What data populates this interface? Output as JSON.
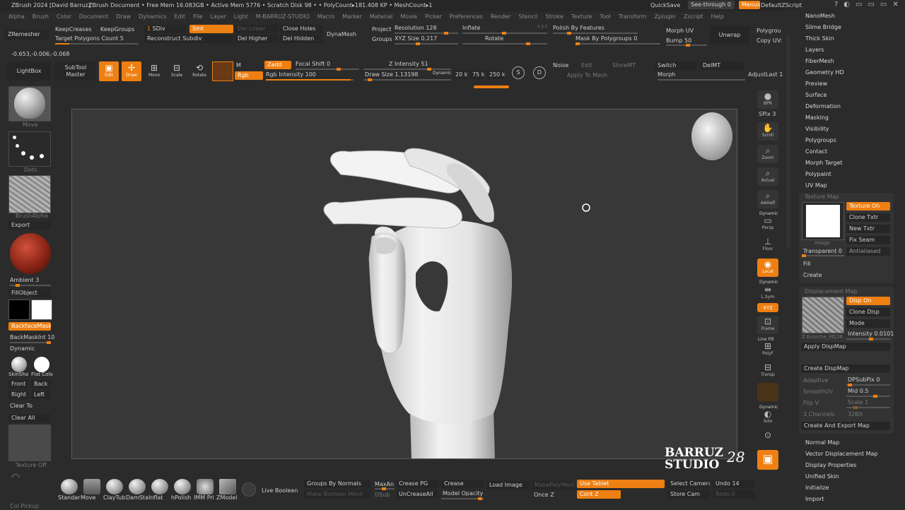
{
  "title_bar": {
    "app": "ZBrush 2024 [David Barruz]",
    "document": "ZBrush Document",
    "stats": "• Free Mem 16.083GB • Active Mem 5776 • Scratch Disk 98 • • PolyCount▸181.408 KP • MeshCount▸1",
    "quicksave": "QuickSave",
    "see_through": "See-through 0",
    "menus": "Menus",
    "default_script": "DefaultZScript"
  },
  "menu": [
    "Alpha",
    "Brush",
    "Color",
    "Document",
    "Draw",
    "Dynamics",
    "Edit",
    "File",
    "Layer",
    "Light",
    "M-BARRUZ-STUDIO",
    "Macro",
    "Marker",
    "Material",
    "Movie",
    "Picker",
    "Preferences",
    "Render",
    "Stencil",
    "Stroke",
    "Texture",
    "Tool",
    "Transform",
    "Zplugin",
    "Zscript",
    "Help"
  ],
  "tool_row1": {
    "zremesher": "ZRemesher",
    "keepcreases": "KeepCreases",
    "keepgroups": "KeepGroups",
    "target": "Target Polygons Count 5",
    "sdiv": "SDiv",
    "sdiv_num": "1",
    "smt": "Smt",
    "reconstruct": "Reconstruct Subdiv",
    "del_lower": "Del Lower",
    "del_higher": "Del Higher",
    "close_holes": "Close Holes",
    "del_hidden": "Del Hidden",
    "dynamesh": "DynaMesh",
    "project": "Project",
    "groups": "Groups",
    "resolution": "Resolution 128",
    "xyz_size": "XYZ Size 0.217",
    "inflate": "Inflate",
    "rotate": "Rotate",
    "xyz_mark": "x y z",
    "polish": "Polish By Features",
    "mask_pg": "Mask By Polygroups 0",
    "morph_uv": "Morph UV",
    "bump": "Bump 50",
    "unwrap": "Unwrap",
    "polygroups": "Polygrou",
    "copy_uv": "Copy UV:"
  },
  "coords": "-0.653,-0.006,-0.068",
  "tool_row2": {
    "lightbox": "LightBox",
    "subtool": "SubTool",
    "master": "Master",
    "edit": "Edit",
    "draw": "Draw",
    "move": "Move",
    "scale": "Scale",
    "rotate": "Rotate",
    "m": "M",
    "zadd": "Zadd",
    "rgb": "Rgb",
    "focal": "Focal Shift 0",
    "rgb_int": "Rgb Intensity 100",
    "z_int": "Z Intensity 51",
    "dynamic": "Dynamic",
    "draw_size": "Draw Size 1.13198",
    "k20": "20 k",
    "k75": "75 k",
    "k250": "250 k",
    "noise": "Noise",
    "edit2": "Edit",
    "storemt": "StoreMT",
    "apply_mesh": "Apply To Mesh",
    "switch": "Switch",
    "delmt": "DelMT",
    "morph": "Morph",
    "adjust": "AdjustLast 1"
  },
  "left_shelf": {
    "move": "Move",
    "dots": "Dots",
    "brush_alpha": "BrushAlpha",
    "export": "Export",
    "ambient": "Ambient 3",
    "fillobject": "FillObject",
    "backfacemask": "BackfaceMask",
    "backmaskint": "BackMaskInt 10",
    "dynamic": "Dynamic",
    "skinshade": "SkinSha",
    "flatcolor": "Flat Colo",
    "front": "Front",
    "back": "Back",
    "right": "Right",
    "left": "Left",
    "clear_to": "Clear To",
    "clear_all": "Clear All",
    "texture_off": "Texture Off",
    "col_pickup": "Col Pickup"
  },
  "right_shelf": {
    "bpr": "BPR",
    "spix": "SPix 3",
    "scroll": "Scroll",
    "zoom": "Zoom",
    "actual": "Actual",
    "aahalf": "AAHalf",
    "dynamic": "Dynamic",
    "persp": "Persp",
    "floor": "Floor",
    "local": "Local",
    "dynamic2": "Dynamic",
    "lsym": "L.Sym",
    "xyz": "XYZ",
    "frame": "Frame",
    "line_fill": "Line Fill",
    "polyf": "PolyF",
    "transp": "Transp",
    "dynamic3": "Dynamic",
    "solo": "Solo"
  },
  "tool_menu": [
    "NanoMesh",
    "Slime Bridge",
    "Thick Skin",
    "Layers",
    "FiberMesh",
    "Geometry HD",
    "Preview",
    "Surface",
    "Deformation",
    "Masking",
    "Visibility",
    "Polygroups",
    "Contact",
    "Morph Target",
    "Polypaint",
    "UV Map"
  ],
  "texture_map": {
    "header": "Texture Map",
    "texture_on": "Texture On",
    "clone_txtr": "Clone Txtr",
    "new_txtr": "New Txtr",
    "fix_seam": "Fix Seam",
    "transparent": "Transparent 0",
    "antialiased": "Antialiased",
    "image": "Image",
    "fill": "Fill",
    "create": "Create"
  },
  "displacement_map": {
    "header": "Displacement Map",
    "disp_on": "Disp On",
    "clone_disp": "Clone Disp",
    "mode": "Mode",
    "intensity": "Intensity 0.0101",
    "thumb_label": "Z Ecorche_M126",
    "apply": "Apply DispMap",
    "create": "Create DispMap",
    "adaptive": "Adaptive",
    "dpsubpix": "DPSubPix 0",
    "smoothuv": "SmoothUV",
    "mid": "Mid 0.5",
    "flipv": "Flip V",
    "scale": "Scale 1",
    "channels": "3 Channels",
    "bit": "32Bit",
    "create_export": "Create And Export Map"
  },
  "tool_menu2": [
    "Normal Map",
    "Vector Displacement Map",
    "Display Properties",
    "Unified Skin",
    "Initialize",
    "Import"
  ],
  "bottom": {
    "brushes": [
      "Standar",
      "Move",
      "ClayTub",
      "DamSta",
      "Inflat",
      "hPolish",
      "IMM Pri",
      "ZModel"
    ],
    "live_boolean": "Live Boolean",
    "groups_normals": "Groups By Normals",
    "make_boolean": "Make Boolean Mesh",
    "max_angle": "MaxAn",
    "dsub": "DSub",
    "crease_pg": "Crease PG",
    "uncrease_all": "UnCreaseAll",
    "crease": "Crease",
    "model_opacity": "Model Opacity",
    "load_image": "Load Image",
    "make_polymesh": "MakePolyMesh",
    "once_z": "Once Z",
    "use_tablet": "Use Tablet",
    "cont_z": "Cont Z",
    "select_camera": "Select Camera",
    "store_cam": "Store Cam",
    "undo": "Undo 14",
    "redo": "Redo 0"
  },
  "watermark": {
    "line1": "BARRUZ",
    "line2": "STUDIO",
    "mark": "28"
  },
  "colors": {
    "accent": "#ee7f12",
    "panel": "#2b2b2b",
    "canvas": "#383838"
  }
}
